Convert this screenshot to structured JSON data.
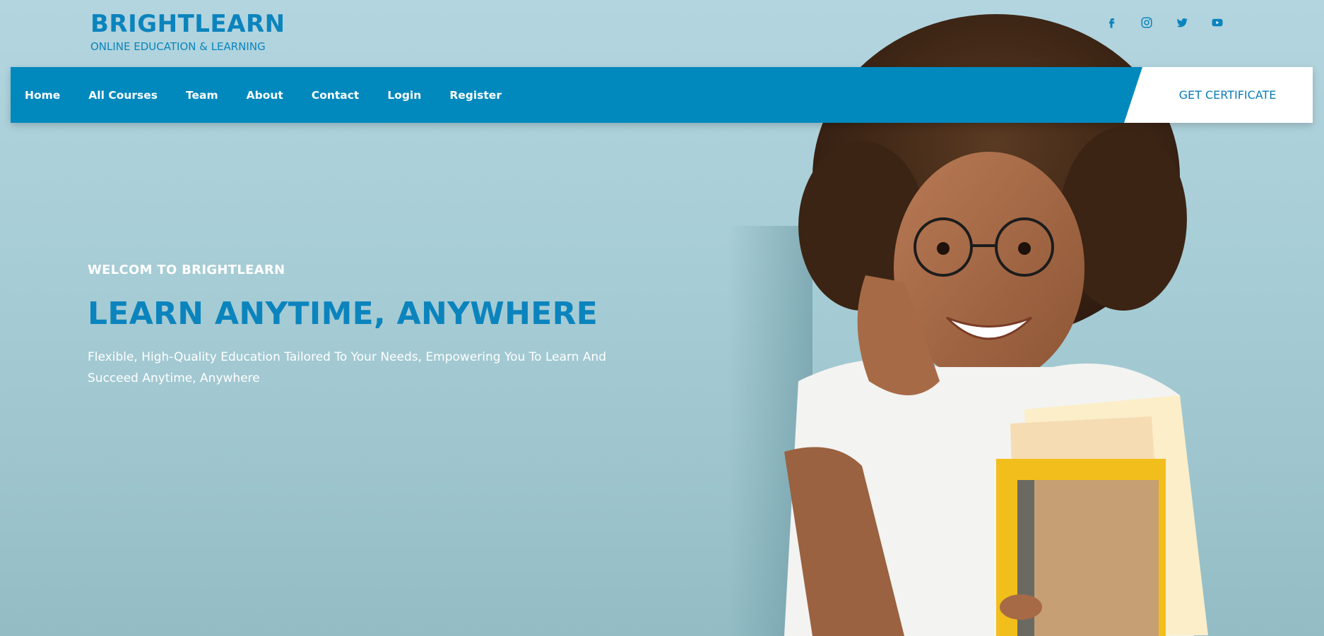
{
  "brand": {
    "name": "BRIGHTLEARN",
    "tagline": "ONLINE EDUCATION & LEARNING"
  },
  "social": [
    {
      "icon": "facebook-icon"
    },
    {
      "icon": "instagram-icon"
    },
    {
      "icon": "twitter-icon"
    },
    {
      "icon": "youtube-icon"
    }
  ],
  "nav": {
    "items": [
      "Home",
      "All Courses",
      "Team",
      "About",
      "Contact",
      "Login",
      "Register"
    ],
    "cta": "GET CERTIFICATE"
  },
  "hero": {
    "kicker": "WELCOM TO BRIGHTLEARN",
    "title": "LEARN ANYTIME, ANYWHERE",
    "subtitle": "Flexible, High-Quality Education Tailored To Your Needs, Empowering You To Learn And Succeed Anytime, Anywhere"
  },
  "colors": {
    "brand": "#0b84bd",
    "navbar": "#0189be",
    "background": "#a7cdd6",
    "cta_bg": "#ffffff"
  }
}
